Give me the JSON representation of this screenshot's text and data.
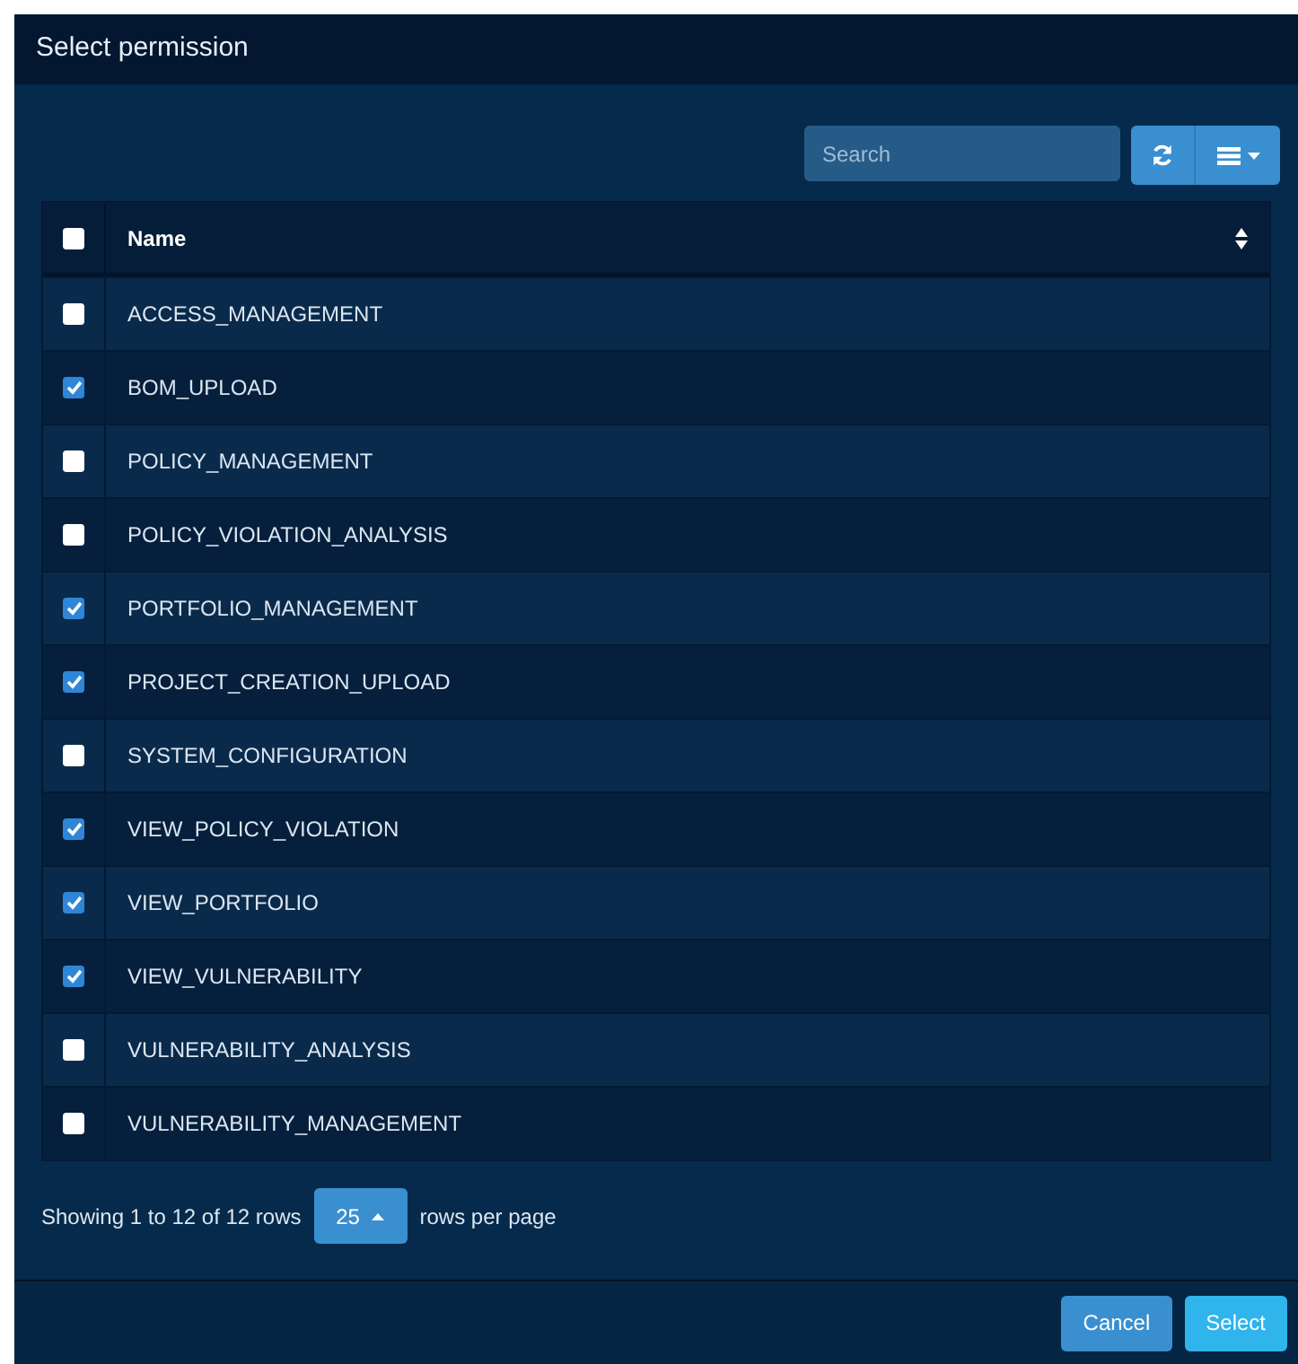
{
  "dialog": {
    "title": "Select permission"
  },
  "toolbar": {
    "search": {
      "placeholder": "Search"
    }
  },
  "table": {
    "header": {
      "checked": false,
      "column": "Name"
    },
    "rows": [
      {
        "name": "ACCESS_MANAGEMENT",
        "checked": false
      },
      {
        "name": "BOM_UPLOAD",
        "checked": true
      },
      {
        "name": "POLICY_MANAGEMENT",
        "checked": false
      },
      {
        "name": "POLICY_VIOLATION_ANALYSIS",
        "checked": false
      },
      {
        "name": "PORTFOLIO_MANAGEMENT",
        "checked": true
      },
      {
        "name": "PROJECT_CREATION_UPLOAD",
        "checked": true
      },
      {
        "name": "SYSTEM_CONFIGURATION",
        "checked": false
      },
      {
        "name": "VIEW_POLICY_VIOLATION",
        "checked": true
      },
      {
        "name": "VIEW_PORTFOLIO",
        "checked": true
      },
      {
        "name": "VIEW_VULNERABILITY",
        "checked": true
      },
      {
        "name": "VULNERABILITY_ANALYSIS",
        "checked": false
      },
      {
        "name": "VULNERABILITY_MANAGEMENT",
        "checked": false
      }
    ]
  },
  "pagination": {
    "summary": "Showing 1 to 12 of 12 rows",
    "page_size": "25",
    "suffix": "rows per page"
  },
  "buttons": [
    {
      "label": "Cancel",
      "kind": "secondary"
    },
    {
      "label": "Select",
      "kind": "primary"
    }
  ]
}
